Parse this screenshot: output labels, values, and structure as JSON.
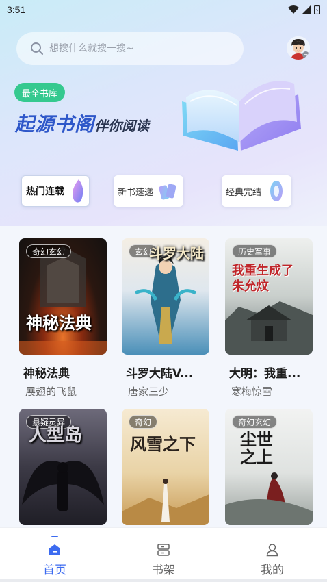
{
  "status_bar": {
    "time": "3:51"
  },
  "search": {
    "placeholder": "想搜什么就搜一搜~"
  },
  "hero": {
    "badge": "最全书库",
    "title": "起源书阁",
    "subtitle": "伴你阅读"
  },
  "categories": [
    {
      "label": "热门连载",
      "active": true
    },
    {
      "label": "新书速递",
      "active": false
    },
    {
      "label": "经典完结",
      "active": false
    }
  ],
  "books": [
    {
      "tag": "奇幻玄幻",
      "cover_title": "神秘法典",
      "title": "神秘法典",
      "author": "展翅的飞鼠"
    },
    {
      "tag": "玄幻",
      "cover_title": "斗罗大陆",
      "title": "斗罗大陆V...",
      "author": "唐家三少"
    },
    {
      "tag": "历史军事",
      "cover_title": "我重生成了朱允炆",
      "title": "大明：我重...",
      "author": "寒梅惊雪"
    },
    {
      "tag": "悬疑灵异",
      "cover_title": "人型岛",
      "title": "",
      "author": ""
    },
    {
      "tag": "奇幻",
      "cover_title": "风雪之下",
      "title": "",
      "author": ""
    },
    {
      "tag": "奇幻玄幻",
      "cover_title": "尘世之上",
      "title": "",
      "author": ""
    }
  ],
  "tabbar": {
    "items": [
      {
        "label": "首页",
        "icon": "home-icon",
        "active": true
      },
      {
        "label": "书架",
        "icon": "bookshelf-icon",
        "active": false
      },
      {
        "label": "我的",
        "icon": "profile-icon",
        "active": false
      }
    ]
  },
  "colors": {
    "accent": "#3c6bf0",
    "badge": "#35c98f",
    "hero_title": "#2e57c9"
  }
}
